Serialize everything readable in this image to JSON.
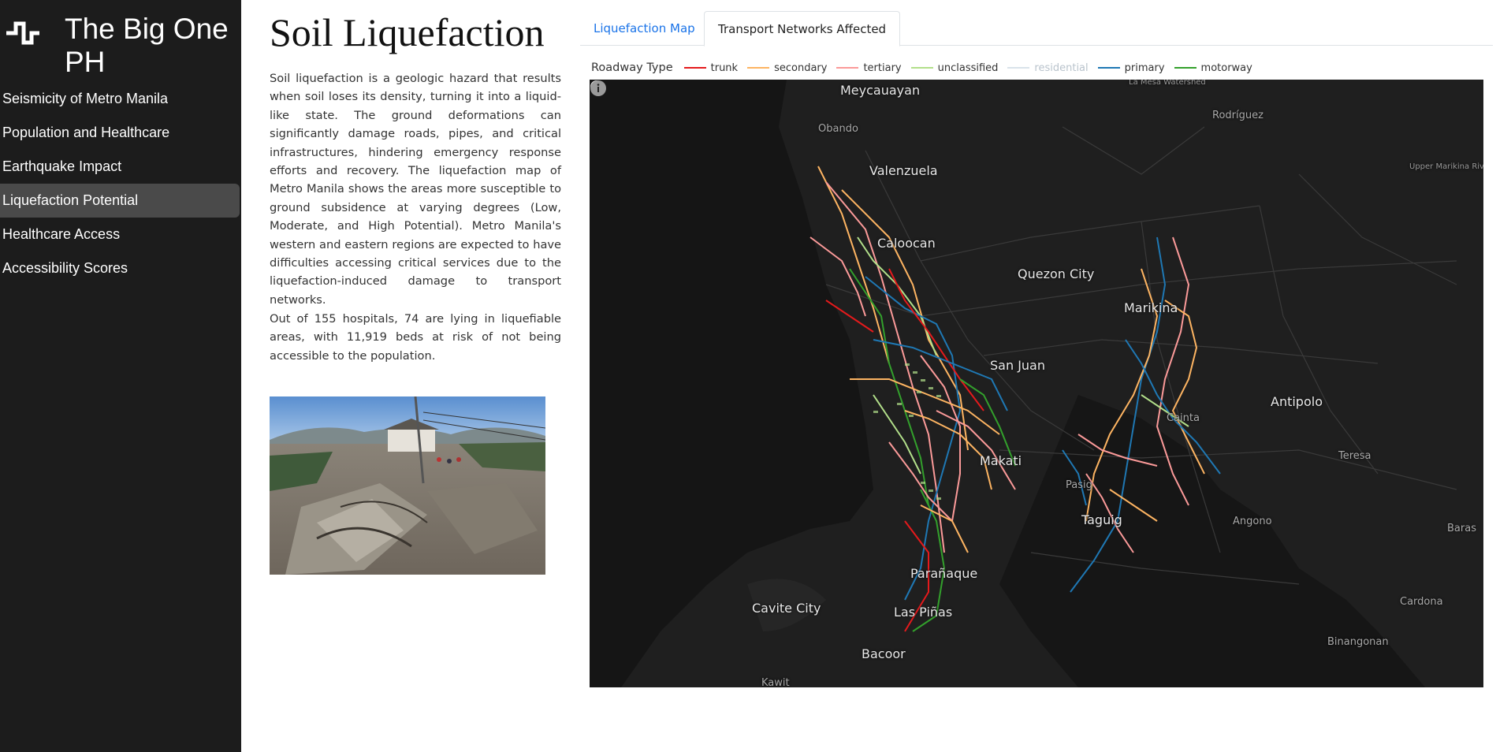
{
  "app": {
    "title": "The Big One PH",
    "logo_icon": "pulse-logo-icon"
  },
  "sidebar": {
    "items": [
      {
        "label": "Seismicity of Metro Manila",
        "active": false
      },
      {
        "label": "Population and Healthcare",
        "active": false
      },
      {
        "label": "Earthquake Impact",
        "active": false
      },
      {
        "label": "Liquefaction Potential",
        "active": true
      },
      {
        "label": "Healthcare Access",
        "active": false
      },
      {
        "label": "Accessibility Scores",
        "active": false
      }
    ]
  },
  "article": {
    "title": "Soil Liquefaction",
    "paragraph_1": "Soil liquefaction is a geologic hazard that results when soil loses its density, turning it into a liquid-like state. The ground deformations can significantly damage roads, pipes, and critical infrastructures, hindering emergency response efforts and recovery. The liquefaction map of Metro Manila shows the areas more susceptible to ground subsidence at varying degrees (Low, Moderate, and High Potential). Metro Manila's western and eastern regions are expected to have difficulties accessing critical services due to the liquefaction-induced damage to transport networks.",
    "paragraph_2": "Out of 155 hospitals, 74 are lying in liquefiable areas, with 11,919 beds at risk of not being accessible to the population."
  },
  "tabs": [
    {
      "label": "Liquefaction Map",
      "active": false
    },
    {
      "label": "Transport Networks Affected",
      "active": true
    }
  ],
  "legend": {
    "title": "Roadway Type",
    "items": [
      {
        "label": "trunk",
        "color": "#e41a1c"
      },
      {
        "label": "secondary",
        "color": "#fdb462"
      },
      {
        "label": "tertiary",
        "color": "#fb9a99"
      },
      {
        "label": "unclassified",
        "color": "#b2df8a"
      },
      {
        "label": "residential",
        "color": "#d9e3ea",
        "muted": true
      },
      {
        "label": "primary",
        "color": "#1f78b4"
      },
      {
        "label": "motorway",
        "color": "#33a02c"
      }
    ]
  },
  "map": {
    "labels": {
      "meycauayan": "Meycauayan",
      "obando": "Obando",
      "valenzuela": "Valenzuela",
      "caloocan": "Caloocan",
      "quezon_city": "Quezon City",
      "marikina": "Marikina",
      "san_juan": "San Juan",
      "antipolo": "Antipolo",
      "cainta": "Cainta",
      "makati": "Makati",
      "pasig": "Pasig",
      "taguig": "Taguig",
      "teresa": "Teresa",
      "angono": "Angono",
      "baras": "Baras",
      "paranaque": "Parañaque",
      "cavite_city": "Cavite City",
      "las_pinas": "Las Piñas",
      "bacoor": "Bacoor",
      "kawit": "Kawit",
      "cardona": "Cardona",
      "binangonan": "Binangonan",
      "rodriguez": "Rodríguez",
      "watershed": "La Mesa Watershed",
      "upper_marikina": "Upper Marikina River Basin Protected Landscape"
    },
    "attribution_icon": "mapbox-logo-icon",
    "info_icon": "info-icon"
  }
}
